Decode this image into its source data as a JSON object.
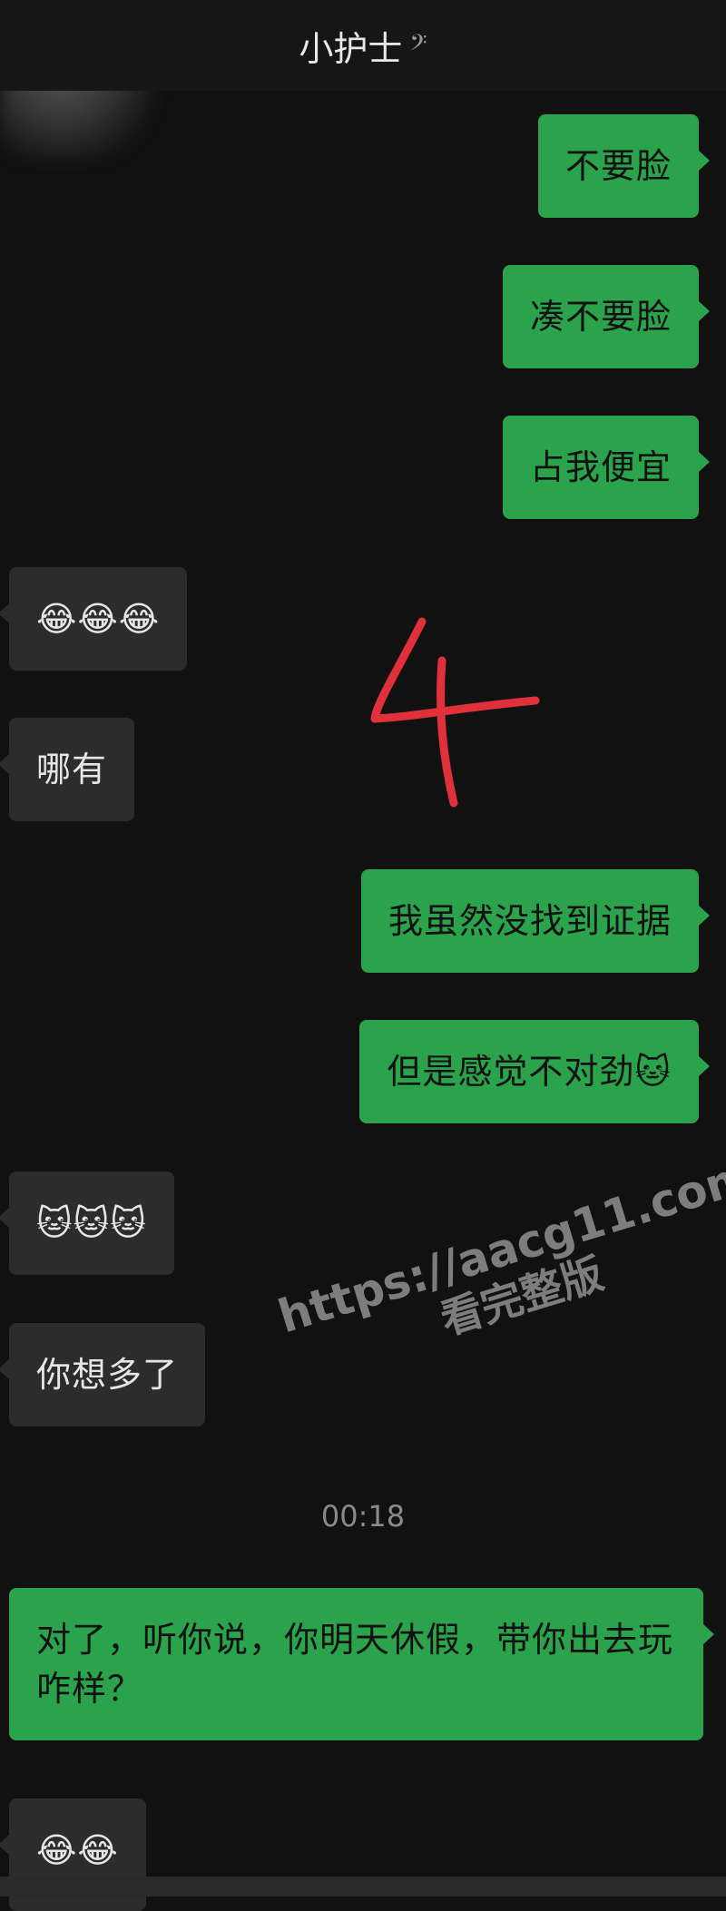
{
  "header": {
    "title": "小护士",
    "ear_icon": "ear-icon"
  },
  "messages": [
    {
      "side": "me",
      "text": "不要脸"
    },
    {
      "side": "me",
      "text": "凑不要脸"
    },
    {
      "side": "me",
      "text": "占我便宜"
    },
    {
      "side": "them",
      "text": "😂😂😂"
    },
    {
      "side": "them",
      "text": "哪有"
    },
    {
      "side": "me",
      "text": "我虽然没找到证据"
    },
    {
      "side": "me",
      "text": "但是感觉不对劲🐱"
    },
    {
      "side": "them",
      "text": "🐱🐱🐱"
    },
    {
      "side": "them",
      "text": "你想多了"
    },
    {
      "side": "me",
      "text": "对了，听你说，你明天休假，带你出去玩咋样？"
    },
    {
      "side": "them",
      "text": "😂😂"
    }
  ],
  "timestamp": "00:18",
  "annotation": "4",
  "watermark": {
    "url": "https://aacg11.com",
    "text": "看完整版"
  },
  "colors": {
    "background": "#111111",
    "my_bubble": "#2ba24c",
    "their_bubble": "#2c2c2c",
    "annotation": "#e0303a"
  }
}
